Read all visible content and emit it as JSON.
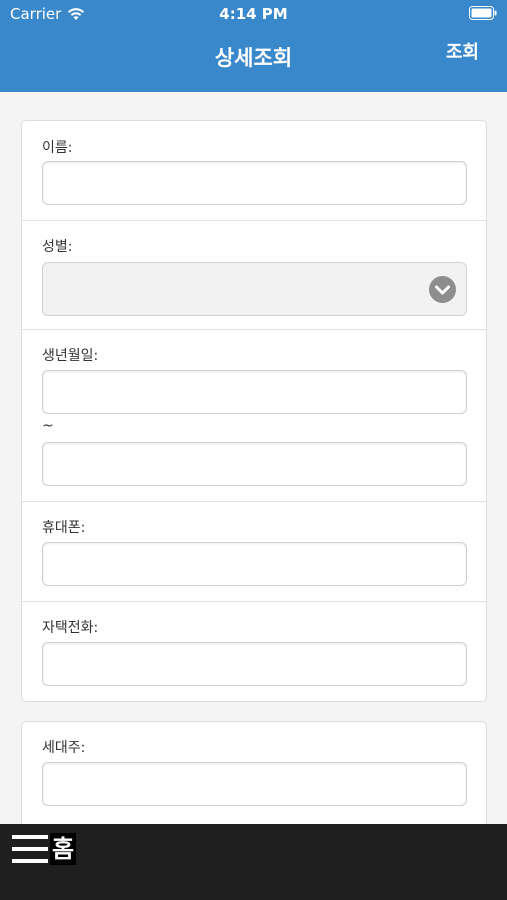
{
  "status_bar": {
    "carrier": "Carrier",
    "time": "4:14 PM",
    "wifi_icon": "wifi-icon",
    "battery_icon": "battery-icon"
  },
  "nav": {
    "title": "상세조회",
    "action_label": "조회",
    "background_color": "#3a88cc"
  },
  "form": {
    "name_label": "이름:",
    "name_value": "",
    "gender_label": "성별:",
    "gender_value": "",
    "birthdate_label": "생년월일:",
    "birthdate_from": "",
    "range_separator": "~",
    "birthdate_to": "",
    "mobile_label": "휴대폰:",
    "mobile_value": "",
    "home_phone_label": "자택전화:",
    "home_phone_value": "",
    "household_head_label": "세대주:",
    "household_head_value": ""
  },
  "tabbar": {
    "menu_icon": "hamburger-menu-icon",
    "home_label": "홈"
  }
}
